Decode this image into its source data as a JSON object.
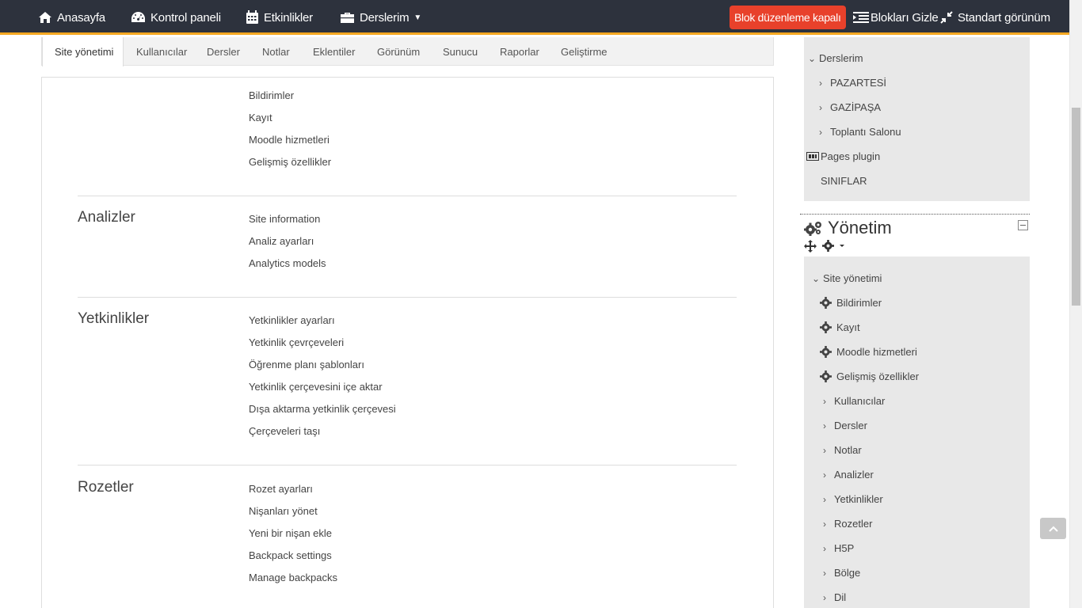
{
  "navbar": {
    "home": "Anasayfa",
    "dashboard": "Kontrol paneli",
    "events": "Etkinlikler",
    "my_courses": "Derslerim",
    "edit_mode": "Blok düzenleme kapalı",
    "hide_blocks": "Blokları Gizle",
    "standard_view": "Standart görünüm"
  },
  "tabs": [
    "Site yönetimi",
    "Kullanıcılar",
    "Dersler",
    "Notlar",
    "Eklentiler",
    "Görünüm",
    "Sunucu",
    "Raporlar",
    "Geliştirme"
  ],
  "main": {
    "top_links": [
      "Bildirimler",
      "Kayıt",
      "Moodle hizmetleri",
      "Gelişmiş özellikler"
    ],
    "sections": [
      {
        "title": "Analizler",
        "links": [
          "Site information",
          "Analiz ayarları",
          "Analytics models"
        ]
      },
      {
        "title": "Yetkinlikler",
        "links": [
          "Yetkinlikler ayarları",
          "Yetkinlik çevrçeveleri",
          "Öğrenme planı şablonları",
          "Yetkinlik çerçevesini içe aktar",
          "Dışa aktarma yetkinlik çerçevesi",
          "Çerçeveleri taşı"
        ]
      },
      {
        "title": "Rozetler",
        "links": [
          "Rozet ayarları",
          "Nişanları yönet",
          "Yeni bir nişan ekle",
          "Backpack settings",
          "Manage backpacks"
        ]
      }
    ]
  },
  "nav_block": {
    "items": [
      "Derslerim",
      "PAZARTESİ",
      "GAZİPAŞA",
      "Toplantı Salonu",
      "Pages plugin",
      "SINIFLAR"
    ]
  },
  "admin_block": {
    "title": "Yönetim",
    "root": "Site yönetimi",
    "settings": [
      "Bildirimler",
      "Kayıt",
      "Moodle hizmetleri",
      "Gelişmiş özellikler"
    ],
    "categories": [
      "Kullanıcılar",
      "Dersler",
      "Notlar",
      "Analizler",
      "Yetkinlikler",
      "Rozetler",
      "H5P",
      "Bölge",
      "Dil"
    ]
  }
}
